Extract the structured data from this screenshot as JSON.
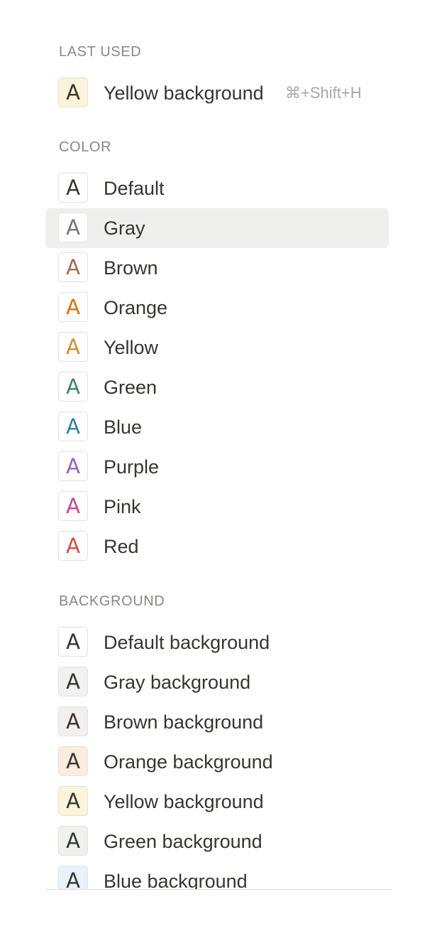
{
  "last_used": {
    "header": "LAST USED",
    "item": {
      "label": "Yellow background",
      "shortcut": "⌘+Shift+H",
      "letter": "A",
      "color": "#37352f",
      "bg": "#fbf3db"
    }
  },
  "color": {
    "header": "COLOR",
    "items": [
      {
        "label": "Default",
        "letter": "A",
        "color": "#37352f",
        "bg": "#ffffff"
      },
      {
        "label": "Gray",
        "letter": "A",
        "color": "#787774",
        "bg": "#ffffff",
        "hovered": true
      },
      {
        "label": "Brown",
        "letter": "A",
        "color": "#9f6b53",
        "bg": "#ffffff"
      },
      {
        "label": "Orange",
        "letter": "A",
        "color": "#d9730d",
        "bg": "#ffffff"
      },
      {
        "label": "Yellow",
        "letter": "A",
        "color": "#cb912f",
        "bg": "#ffffff"
      },
      {
        "label": "Green",
        "letter": "A",
        "color": "#448361",
        "bg": "#ffffff"
      },
      {
        "label": "Blue",
        "letter": "A",
        "color": "#337ea9",
        "bg": "#ffffff"
      },
      {
        "label": "Purple",
        "letter": "A",
        "color": "#9065b0",
        "bg": "#ffffff"
      },
      {
        "label": "Pink",
        "letter": "A",
        "color": "#c14c8a",
        "bg": "#ffffff"
      },
      {
        "label": "Red",
        "letter": "A",
        "color": "#d44c47",
        "bg": "#ffffff"
      }
    ]
  },
  "background": {
    "header": "BACKGROUND",
    "items": [
      {
        "label": "Default background",
        "letter": "A",
        "color": "#37352f",
        "bg": "#ffffff"
      },
      {
        "label": "Gray background",
        "letter": "A",
        "color": "#37352f",
        "bg": "#f1f1ef"
      },
      {
        "label": "Brown background",
        "letter": "A",
        "color": "#37352f",
        "bg": "#f4eeee"
      },
      {
        "label": "Orange background",
        "letter": "A",
        "color": "#37352f",
        "bg": "#fbecdd"
      },
      {
        "label": "Yellow background",
        "letter": "A",
        "color": "#37352f",
        "bg": "#fbf3db"
      },
      {
        "label": "Green background",
        "letter": "A",
        "color": "#37352f",
        "bg": "#edf3ec"
      },
      {
        "label": "Blue background",
        "letter": "A",
        "color": "#37352f",
        "bg": "#e7f3f8"
      }
    ]
  }
}
